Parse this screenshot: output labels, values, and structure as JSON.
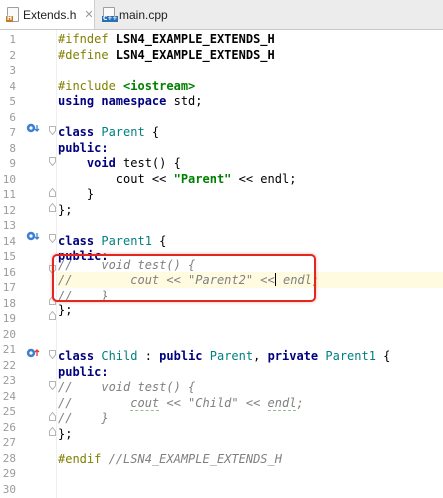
{
  "tabs": [
    {
      "name": "Extends.h",
      "badge": "H",
      "active": true
    },
    {
      "name": "main.cpp",
      "badge": "C++",
      "active": false
    }
  ],
  "close_glyph": "✕",
  "line_numbers": [
    "1",
    "2",
    "3",
    "4",
    "5",
    "6",
    "7",
    "8",
    "9",
    "10",
    "11",
    "12",
    "13",
    "14",
    "15",
    "16",
    "17",
    "18",
    "19",
    "20",
    "21",
    "22",
    "23",
    "24",
    "25",
    "26",
    "27",
    "28",
    "29",
    "30"
  ],
  "code": {
    "l1": {
      "a": "#ifndef ",
      "b": "LSN4_EXAMPLE_EXTENDS_H"
    },
    "l2": {
      "a": "#define ",
      "b": "LSN4_EXAMPLE_EXTENDS_H"
    },
    "l4": {
      "a": "#include ",
      "b": "<iostream>"
    },
    "l5": {
      "a": "using namespace",
      "b": " std;"
    },
    "l7": {
      "a": "class",
      "b": " Parent",
      "c": " {"
    },
    "l8": {
      "a": "public:"
    },
    "l9": {
      "a": "    void",
      "b": " test() {"
    },
    "l10": {
      "a": "        cout << ",
      "b": "\"Parent\"",
      "c": " << endl;"
    },
    "l11": {
      "a": "    }"
    },
    "l12": {
      "a": "};"
    },
    "l14": {
      "a": "class",
      "b": " Parent1",
      "c": " {"
    },
    "l15": {
      "a": "public:"
    },
    "l16": {
      "a": "//    void test() {"
    },
    "l17": {
      "a": "//        cout << \"Parent2\" <<",
      "b": " endl;"
    },
    "l18": {
      "a": "//    }"
    },
    "l19": {
      "a": "};"
    },
    "l22": {
      "a": "class",
      "b": " Child",
      "c": " : ",
      "d": "public",
      "e": " Parent",
      "f": ", ",
      "g": "private",
      "h": " Parent1",
      "i": " {"
    },
    "l23": {
      "a": "public:"
    },
    "l24": {
      "a": "//    void test() {"
    },
    "l25": {
      "a": "//        ",
      "b": "cout",
      "c": " << \"Child\" << ",
      "d": "endl",
      "e": ";"
    },
    "l26": {
      "a": "//    }"
    },
    "l27": {
      "a": "};"
    },
    "l29": {
      "a": "#endif ",
      "b": "//LSN4_EXAMPLE_EXTENDS_H"
    }
  },
  "colors": {
    "highlight_border": "#e0281f",
    "keyword": "#000080",
    "string": "#008000",
    "comment": "#808080",
    "class_name": "#008080",
    "preprocessor": "#808000"
  },
  "icons": {
    "override_marker": "overridden-method-icon",
    "implements_marker": "implementing-icon",
    "fold": "fold-icon"
  }
}
